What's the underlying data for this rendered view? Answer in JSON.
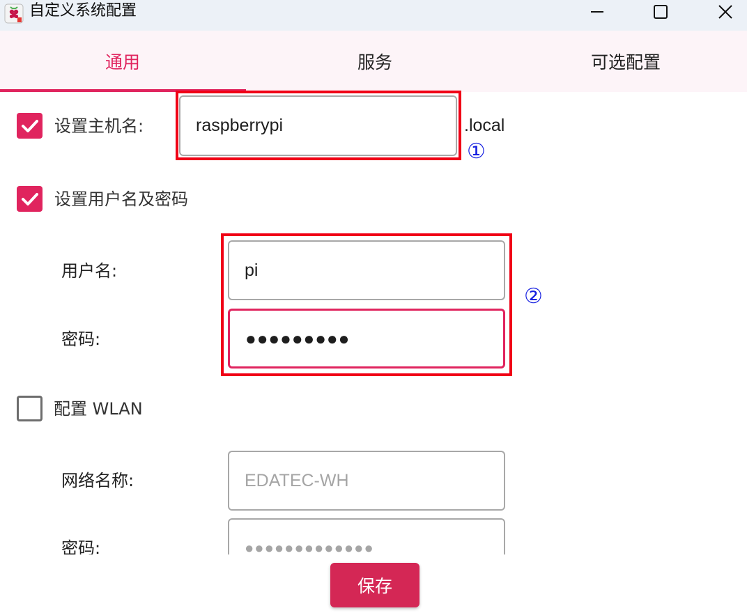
{
  "window": {
    "title": "自定义系统配置",
    "app_icon": "raspberry-pi-icon",
    "controls": [
      "minimize-icon",
      "maximize-icon",
      "close-icon"
    ]
  },
  "tabs": [
    {
      "label": "通用",
      "active": true
    },
    {
      "label": "服务",
      "active": false
    },
    {
      "label": "可选配置",
      "active": false
    }
  ],
  "hostname": {
    "checkbox_label": "设置主机名:",
    "checked": true,
    "value": "raspberrypi",
    "suffix": ".local",
    "annotation": "①"
  },
  "user": {
    "checkbox_label": "设置用户名及密码",
    "checked": true,
    "username_label": "用户名:",
    "username_value": "pi",
    "password_label": "密码:",
    "password_value": "●●●●●●●●●",
    "annotation": "②"
  },
  "wlan": {
    "checkbox_label": "配置 WLAN",
    "checked": false,
    "ssid_label": "网络名称:",
    "ssid_placeholder": "EDATEC-WH",
    "password_label": "密码:",
    "password_placeholder": "●●●●●●●●●●●●●"
  },
  "footer": {
    "save_label": "保存"
  },
  "colors": {
    "accent": "#e0245e",
    "save_button": "#d42755",
    "highlight": "#f00016",
    "annotation": "#1620e0"
  }
}
